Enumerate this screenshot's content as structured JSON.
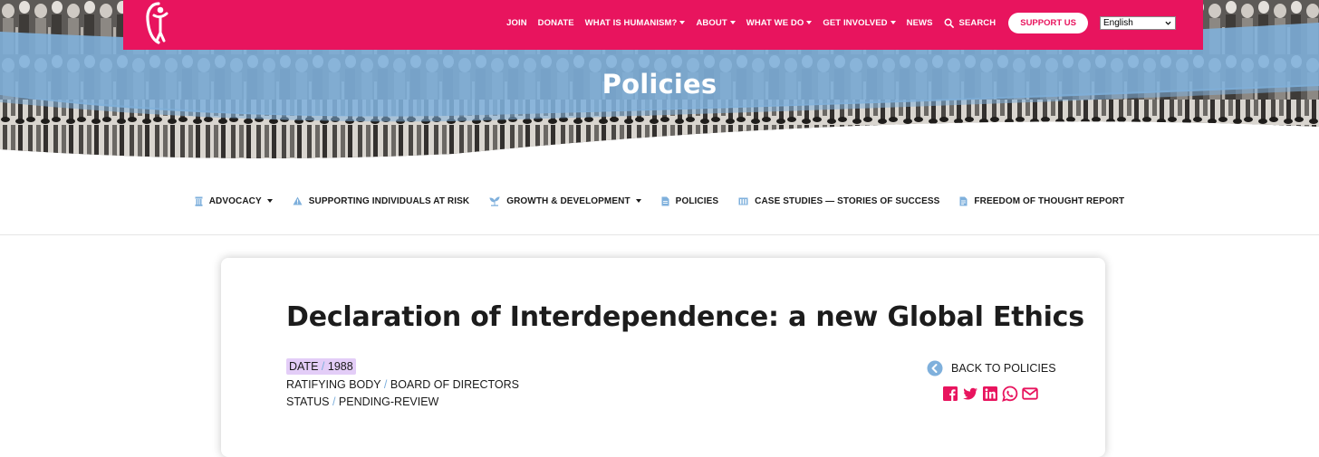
{
  "header": {
    "nav": [
      {
        "label": "JOIN",
        "dropdown": false
      },
      {
        "label": "DONATE",
        "dropdown": false
      },
      {
        "label": "WHAT IS HUMANISM?",
        "dropdown": true
      },
      {
        "label": "ABOUT",
        "dropdown": true
      },
      {
        "label": "WHAT WE DO",
        "dropdown": true
      },
      {
        "label": "GET INVOLVED",
        "dropdown": true
      },
      {
        "label": "NEWS",
        "dropdown": false
      }
    ],
    "search_label": "SEARCH",
    "support_label": "SUPPORT US",
    "language": "English",
    "colors": {
      "brand": "#e8145e",
      "accent_blue": "#7fb0dc"
    }
  },
  "hero": {
    "title": "Policies"
  },
  "subnav": [
    {
      "label": "ADVOCACY",
      "icon": "pillar-icon",
      "dropdown": true
    },
    {
      "label": "SUPPORTING INDIVIDUALS AT RISK",
      "icon": "warning-icon",
      "dropdown": false
    },
    {
      "label": "GROWTH & DEVELOPMENT",
      "icon": "plant-icon",
      "dropdown": true
    },
    {
      "label": "POLICIES",
      "icon": "document-icon",
      "dropdown": false
    },
    {
      "label": "CASE STUDIES — STORIES OF SUCCESS",
      "icon": "building-icon",
      "dropdown": false
    },
    {
      "label": "FREEDOM OF THOUGHT REPORT",
      "icon": "report-icon",
      "dropdown": false
    }
  ],
  "document": {
    "title": "Declaration of Interdependence: a new Global Ethics",
    "meta": {
      "date_label": "DATE",
      "date_value": "1988",
      "body_label": "RATIFYING BODY",
      "body_value": "BOARD OF DIRECTORS",
      "status_label": "STATUS",
      "status_value": "PENDING-REVIEW",
      "separator": "/"
    },
    "back_label": "BACK TO POLICIES",
    "share_icons": [
      "facebook-icon",
      "twitter-icon",
      "linkedin-icon",
      "whatsapp-icon",
      "email-icon"
    ]
  }
}
